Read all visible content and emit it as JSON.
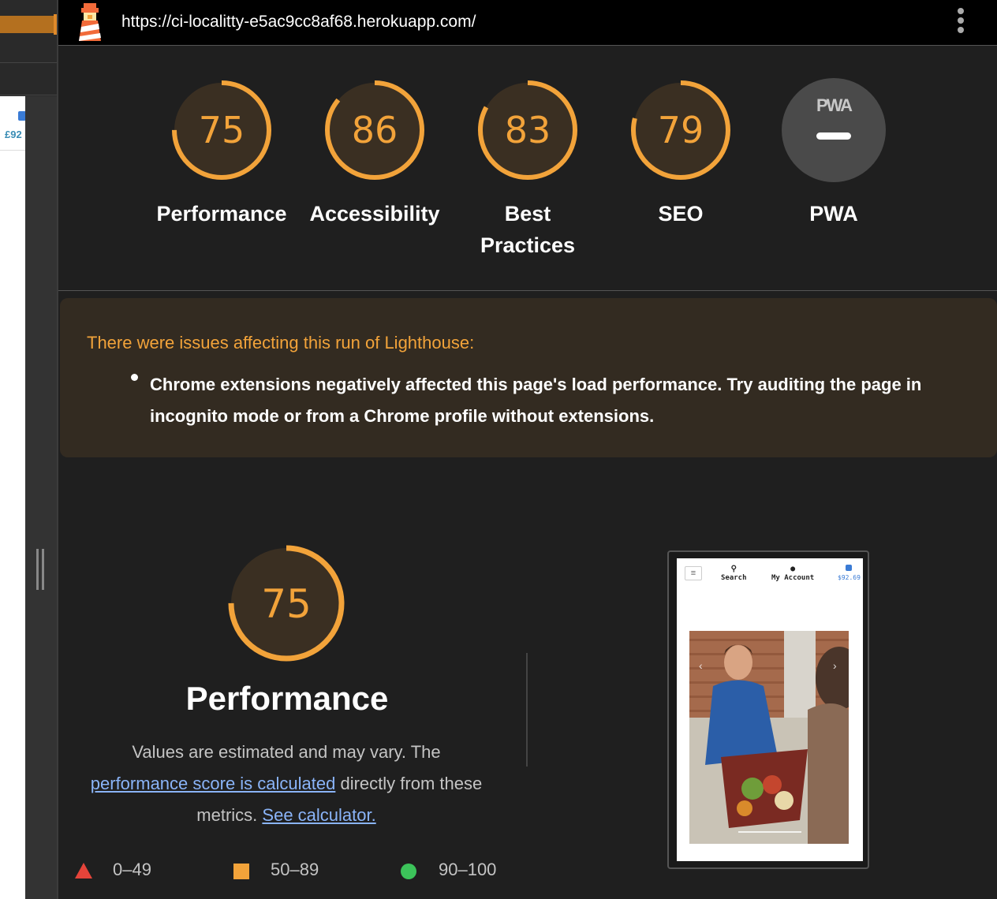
{
  "browser": {
    "url": "https://ci-localitty-e5ac9cc8af68.herokuapp.com/",
    "left_page_price": "£92"
  },
  "gauges": [
    {
      "label": "Performance",
      "score": "75",
      "value": 75,
      "color": "#f2a33a"
    },
    {
      "label": "Accessibility",
      "score": "86",
      "value": 86,
      "color": "#f2a33a"
    },
    {
      "label": "Best Practices",
      "score": "83",
      "value": 83,
      "color": "#f2a33a"
    },
    {
      "label": "SEO",
      "score": "79",
      "value": 79,
      "color": "#f2a33a"
    },
    {
      "label": "PWA",
      "badge": "PWA",
      "value": null,
      "color": "#4a4a4a"
    }
  ],
  "warning": {
    "title": "There were issues affecting this run of Lighthouse:",
    "items": [
      "Chrome extensions negatively affected this page's load performance. Try auditing the page in incognito mode or from a Chrome profile without extensions."
    ]
  },
  "performance": {
    "score": "75",
    "value": 75,
    "title": "Performance",
    "desc_part1": "Values are estimated and may vary. The",
    "desc_link1": "performance score is calculated",
    "desc_part2": "directly from these metrics.",
    "desc_link2": "See calculator."
  },
  "legend": [
    {
      "range": "0–49",
      "shape": "triangle",
      "color": "#e5443a"
    },
    {
      "range": "50–89",
      "shape": "square",
      "color": "#f2a33a"
    },
    {
      "range": "90–100",
      "shape": "circle",
      "color": "#3cc35a"
    }
  ],
  "thumbnail": {
    "menu_icon": "hamburger-icon",
    "search_label": "Search",
    "account_label": "My Account",
    "price": "$92.69"
  },
  "colors": {
    "background": "#1f1f1f",
    "average": "#f2a33a",
    "link": "#8ab4f8"
  }
}
